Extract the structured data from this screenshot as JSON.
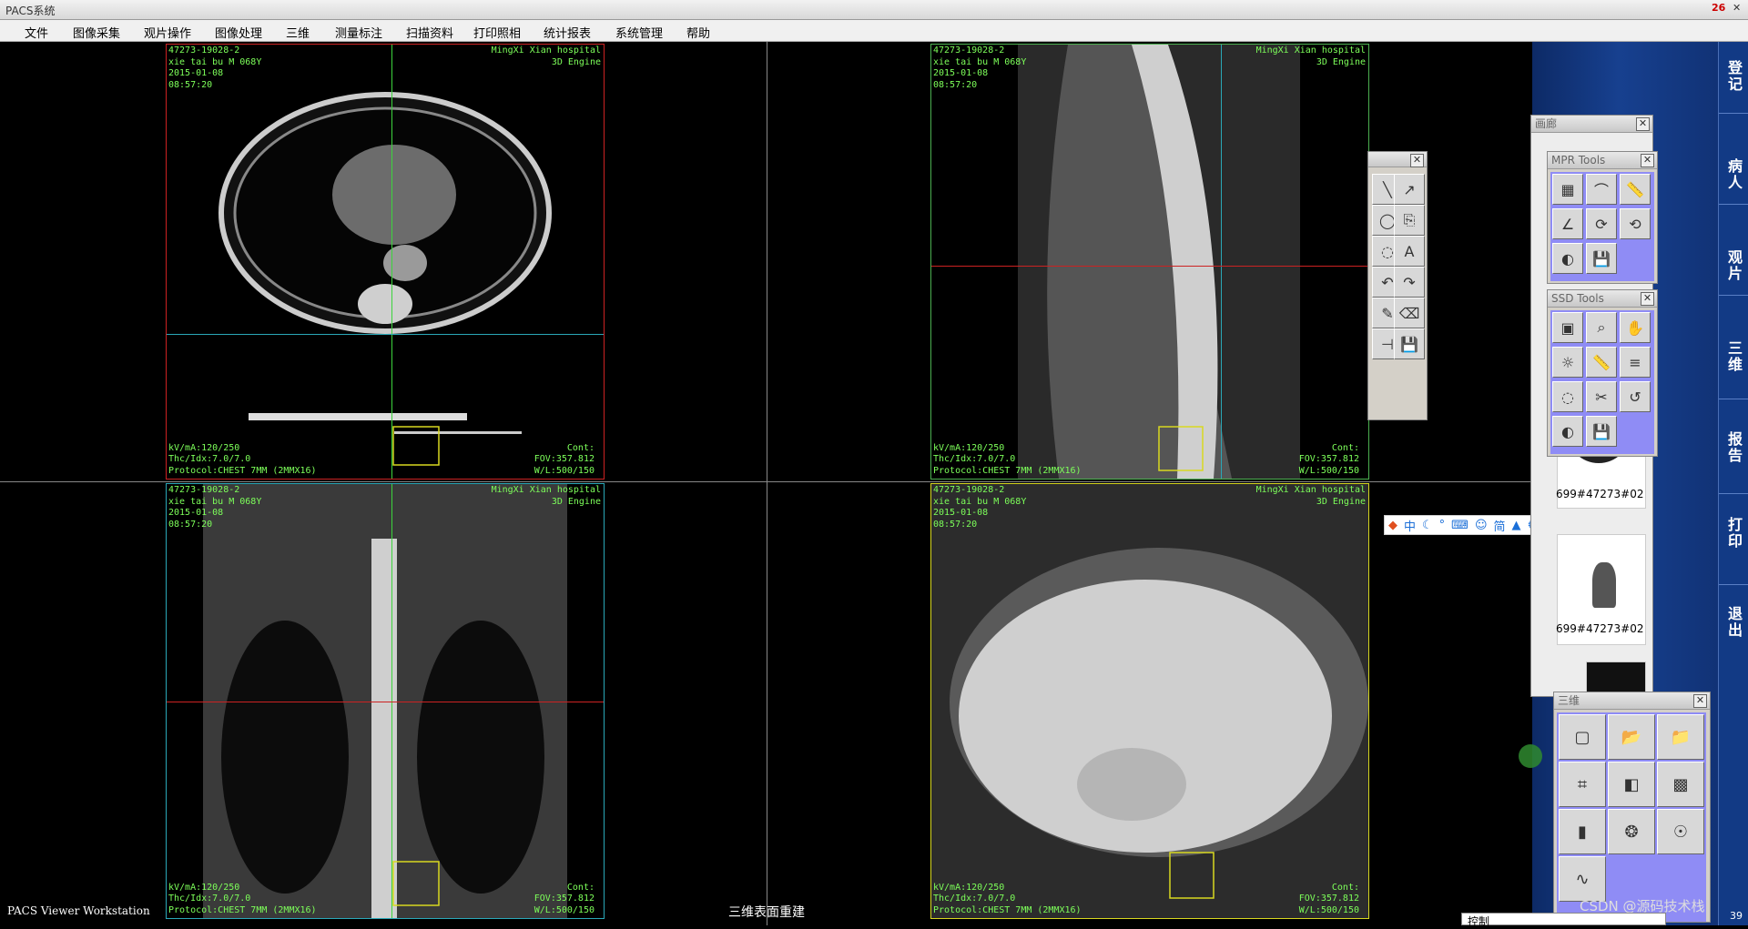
{
  "app": {
    "title": "PACS系统",
    "corner_code": "26"
  },
  "menu": {
    "items": [
      "文件",
      "图像采集",
      "观片操作",
      "图像处理",
      "三维",
      "测量标注",
      "扫描资料",
      "打印照相",
      "统计报表",
      "系统管理",
      "帮助"
    ]
  },
  "viewer": {
    "panes": [
      {
        "name": "axial",
        "tl": "47273-19028-2\nxie tai bu M 068Y\n2015-01-08\n08:57:20",
        "tr": "MingXi Xian hospital\n3D Engine",
        "bl": "kV/mA:120/250\nThc/Idx:7.0/7.0\nProtocol:CHEST 7MM (2MMX16)",
        "br": "Cont:\nFOV:357.812\nW/L:500/150",
        "frame_color": "#cc2222"
      },
      {
        "name": "sagittal",
        "tl": "47273-19028-2\nxie tai bu M 068Y\n2015-01-08\n08:57:20",
        "tr": "MingXi Xian hospital\n3D Engine",
        "bl": "kV/mA:120/250\nThc/Idx:7.0/7.0\nProtocol:CHEST 7MM (2MMX16)",
        "br": "Cont:\nFOV:357.812\nW/L:500/150",
        "frame_color": "#4caf50"
      },
      {
        "name": "coronal",
        "tl": "47273-19028-2\nxie tai bu M 068Y\n2015-01-08\n08:57:20",
        "tr": "MingXi Xian hospital\n3D Engine",
        "bl": "kV/mA:120/250\nThc/Idx:7.0/7.0\nProtocol:CHEST 7MM (2MMX16)",
        "br": "Cont:\nFOV:357.812\nW/L:500/150",
        "frame_color": "#2aa8b8"
      },
      {
        "name": "ssd",
        "tl": "47273-19028-2\nxie tai bu M 068Y\n2015-01-08\n08:57:20",
        "tr": "MingXi Xian hospital\n3D Engine",
        "bl": "kV/mA:120/250\nThc/Idx:7.0/7.0\nProtocol:CHEST 7MM (2MMX16)",
        "br": "Cont:\nFOV:357.812\nW/L:500/150",
        "frame_color": "#d8d820"
      }
    ],
    "status_left": "PACS Viewer Workstation",
    "status_center": "三维表面重建"
  },
  "sidebar": {
    "tabs": [
      "登记",
      "病人",
      "观片",
      "三维",
      "报告",
      "打印",
      "退出"
    ],
    "gallery_title": "画廊",
    "thumbs": [
      "699#47273#02",
      "699#47273#02"
    ]
  },
  "tools": {
    "mpr_title": "MPR Tools",
    "ssd_title": "SSD Tools",
    "threed_title": "三维"
  },
  "ime": {
    "lang": "中",
    "simp": "简"
  },
  "watermark": "CSDN @源码技术栈",
  "bottom_window": {
    "label": "控制"
  },
  "bottom_time": "39",
  "colors": {
    "overlay_text": "#7dff5a",
    "tool_bg": "#8f8cf5",
    "sidebar_bg": "#17408f"
  }
}
